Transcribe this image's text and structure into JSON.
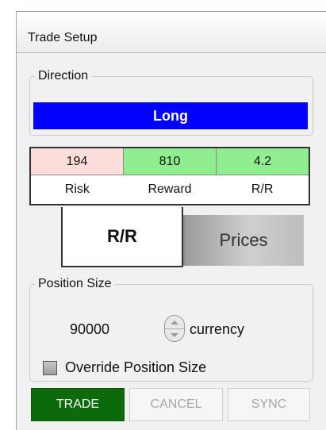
{
  "window": {
    "title": "Trade Setup"
  },
  "direction": {
    "legend": "Direction",
    "value": "Long",
    "color": "#0000ff"
  },
  "rr_table": {
    "values": {
      "risk": "194",
      "reward": "810",
      "ratio": "4.2"
    },
    "labels": {
      "risk": "Risk",
      "reward": "Reward",
      "ratio": "R/R"
    },
    "colors": {
      "risk": "#fddcdc",
      "reward": "#90ee90",
      "ratio": "#90ee90"
    }
  },
  "tabs": [
    {
      "label": "R/R",
      "active": true
    },
    {
      "label": "Prices",
      "active": false
    }
  ],
  "position_size": {
    "legend": "Position Size",
    "value": "90000",
    "unit": "currency",
    "override_label": "Override Position Size",
    "override_checked": false
  },
  "buttons": {
    "trade": "TRADE",
    "cancel": "CANCEL",
    "sync": "SYNC",
    "trade_color": "#0b6b0b"
  },
  "icons": {
    "spinner_up": "chevron-up-icon",
    "spinner_down": "chevron-down-icon"
  }
}
